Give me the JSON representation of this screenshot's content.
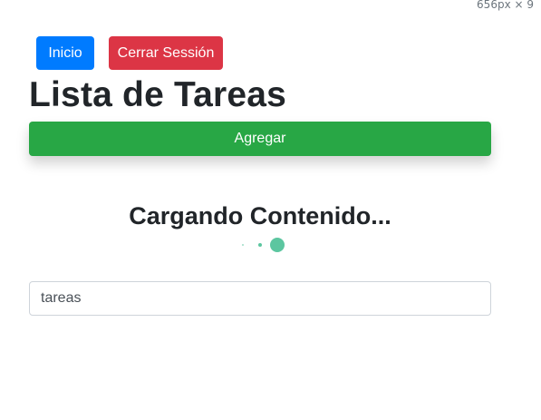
{
  "viewport_indicator": "656px × 9",
  "nav": {
    "home_label": "Inicio",
    "logout_label": "Cerrar Sessión"
  },
  "page_title": "Lista de Tareas",
  "add_button_label": "Agregar",
  "loading": {
    "text": "Cargando Contenido...",
    "spinner_color": "#5cc6a0"
  },
  "search": {
    "value": "tareas"
  },
  "colors": {
    "primary": "#007bff",
    "danger": "#dc3545",
    "success": "#28a745"
  }
}
